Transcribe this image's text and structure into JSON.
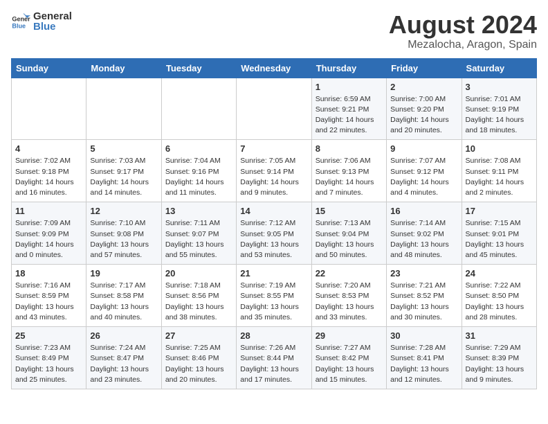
{
  "header": {
    "logo_general": "General",
    "logo_blue": "Blue",
    "title": "August 2024",
    "subtitle": "Mezalocha, Aragon, Spain"
  },
  "calendar": {
    "days_of_week": [
      "Sunday",
      "Monday",
      "Tuesday",
      "Wednesday",
      "Thursday",
      "Friday",
      "Saturday"
    ],
    "weeks": [
      [
        {
          "day": "",
          "info": ""
        },
        {
          "day": "",
          "info": ""
        },
        {
          "day": "",
          "info": ""
        },
        {
          "day": "",
          "info": ""
        },
        {
          "day": "1",
          "info": "Sunrise: 6:59 AM\nSunset: 9:21 PM\nDaylight: 14 hours\nand 22 minutes."
        },
        {
          "day": "2",
          "info": "Sunrise: 7:00 AM\nSunset: 9:20 PM\nDaylight: 14 hours\nand 20 minutes."
        },
        {
          "day": "3",
          "info": "Sunrise: 7:01 AM\nSunset: 9:19 PM\nDaylight: 14 hours\nand 18 minutes."
        }
      ],
      [
        {
          "day": "4",
          "info": "Sunrise: 7:02 AM\nSunset: 9:18 PM\nDaylight: 14 hours\nand 16 minutes."
        },
        {
          "day": "5",
          "info": "Sunrise: 7:03 AM\nSunset: 9:17 PM\nDaylight: 14 hours\nand 14 minutes."
        },
        {
          "day": "6",
          "info": "Sunrise: 7:04 AM\nSunset: 9:16 PM\nDaylight: 14 hours\nand 11 minutes."
        },
        {
          "day": "7",
          "info": "Sunrise: 7:05 AM\nSunset: 9:14 PM\nDaylight: 14 hours\nand 9 minutes."
        },
        {
          "day": "8",
          "info": "Sunrise: 7:06 AM\nSunset: 9:13 PM\nDaylight: 14 hours\nand 7 minutes."
        },
        {
          "day": "9",
          "info": "Sunrise: 7:07 AM\nSunset: 9:12 PM\nDaylight: 14 hours\nand 4 minutes."
        },
        {
          "day": "10",
          "info": "Sunrise: 7:08 AM\nSunset: 9:11 PM\nDaylight: 14 hours\nand 2 minutes."
        }
      ],
      [
        {
          "day": "11",
          "info": "Sunrise: 7:09 AM\nSunset: 9:09 PM\nDaylight: 14 hours\nand 0 minutes."
        },
        {
          "day": "12",
          "info": "Sunrise: 7:10 AM\nSunset: 9:08 PM\nDaylight: 13 hours\nand 57 minutes."
        },
        {
          "day": "13",
          "info": "Sunrise: 7:11 AM\nSunset: 9:07 PM\nDaylight: 13 hours\nand 55 minutes."
        },
        {
          "day": "14",
          "info": "Sunrise: 7:12 AM\nSunset: 9:05 PM\nDaylight: 13 hours\nand 53 minutes."
        },
        {
          "day": "15",
          "info": "Sunrise: 7:13 AM\nSunset: 9:04 PM\nDaylight: 13 hours\nand 50 minutes."
        },
        {
          "day": "16",
          "info": "Sunrise: 7:14 AM\nSunset: 9:02 PM\nDaylight: 13 hours\nand 48 minutes."
        },
        {
          "day": "17",
          "info": "Sunrise: 7:15 AM\nSunset: 9:01 PM\nDaylight: 13 hours\nand 45 minutes."
        }
      ],
      [
        {
          "day": "18",
          "info": "Sunrise: 7:16 AM\nSunset: 8:59 PM\nDaylight: 13 hours\nand 43 minutes."
        },
        {
          "day": "19",
          "info": "Sunrise: 7:17 AM\nSunset: 8:58 PM\nDaylight: 13 hours\nand 40 minutes."
        },
        {
          "day": "20",
          "info": "Sunrise: 7:18 AM\nSunset: 8:56 PM\nDaylight: 13 hours\nand 38 minutes."
        },
        {
          "day": "21",
          "info": "Sunrise: 7:19 AM\nSunset: 8:55 PM\nDaylight: 13 hours\nand 35 minutes."
        },
        {
          "day": "22",
          "info": "Sunrise: 7:20 AM\nSunset: 8:53 PM\nDaylight: 13 hours\nand 33 minutes."
        },
        {
          "day": "23",
          "info": "Sunrise: 7:21 AM\nSunset: 8:52 PM\nDaylight: 13 hours\nand 30 minutes."
        },
        {
          "day": "24",
          "info": "Sunrise: 7:22 AM\nSunset: 8:50 PM\nDaylight: 13 hours\nand 28 minutes."
        }
      ],
      [
        {
          "day": "25",
          "info": "Sunrise: 7:23 AM\nSunset: 8:49 PM\nDaylight: 13 hours\nand 25 minutes."
        },
        {
          "day": "26",
          "info": "Sunrise: 7:24 AM\nSunset: 8:47 PM\nDaylight: 13 hours\nand 23 minutes."
        },
        {
          "day": "27",
          "info": "Sunrise: 7:25 AM\nSunset: 8:46 PM\nDaylight: 13 hours\nand 20 minutes."
        },
        {
          "day": "28",
          "info": "Sunrise: 7:26 AM\nSunset: 8:44 PM\nDaylight: 13 hours\nand 17 minutes."
        },
        {
          "day": "29",
          "info": "Sunrise: 7:27 AM\nSunset: 8:42 PM\nDaylight: 13 hours\nand 15 minutes."
        },
        {
          "day": "30",
          "info": "Sunrise: 7:28 AM\nSunset: 8:41 PM\nDaylight: 13 hours\nand 12 minutes."
        },
        {
          "day": "31",
          "info": "Sunrise: 7:29 AM\nSunset: 8:39 PM\nDaylight: 13 hours\nand 9 minutes."
        }
      ]
    ]
  }
}
